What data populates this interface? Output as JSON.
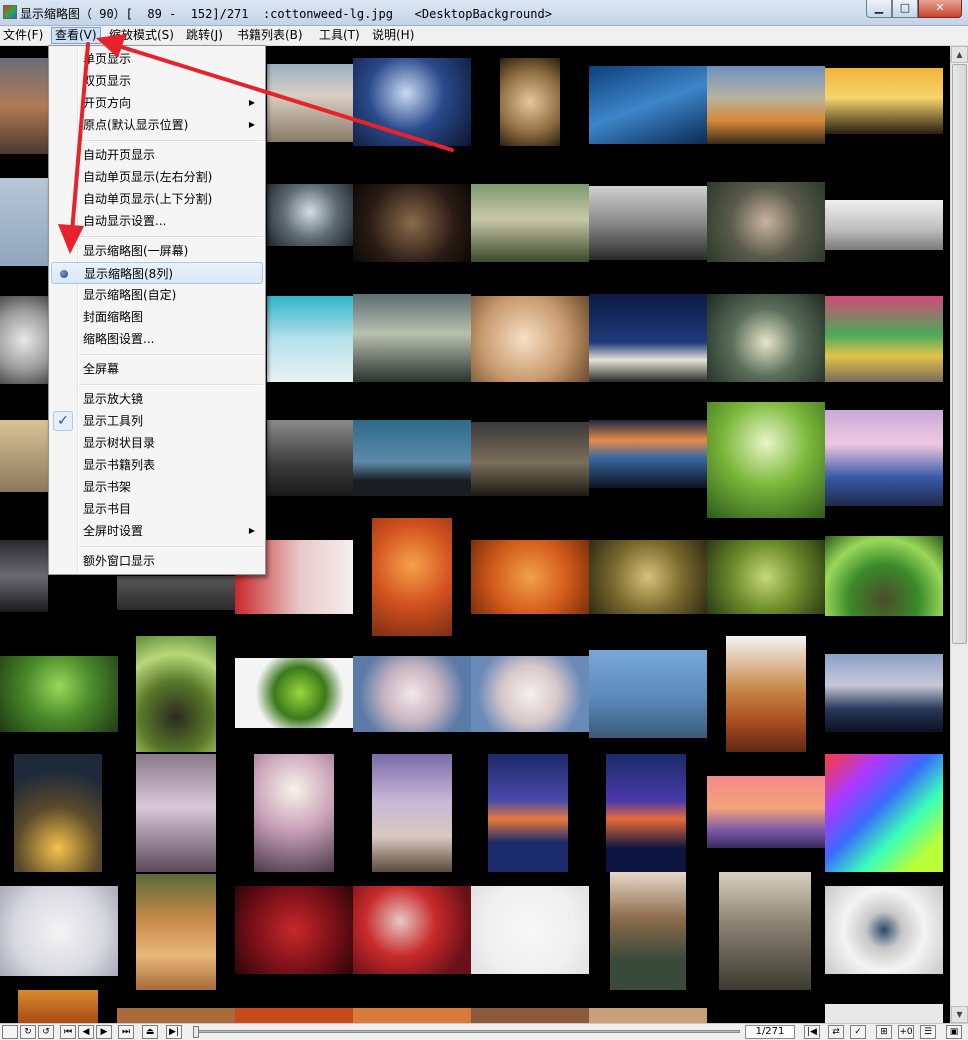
{
  "window": {
    "title": "显示缩略图（ 90）[  89 -  152]/271  :cottonweed-lg.jpg   <DesktopBackground>",
    "minimize_glyph": "▁",
    "maximize_glyph": "□",
    "close_glyph": "✕"
  },
  "menubar": {
    "file": "文件(F)",
    "view": "查看(V)",
    "zoom": "缩放模式(S)",
    "jump": "跳转(J)",
    "books": "书籍列表(B)",
    "tools": "工具(T)",
    "help": "说明(H)"
  },
  "view_menu": {
    "single_page": "单页显示",
    "double_page": "双页显示",
    "page_direction": "开页方向",
    "origin": "原点(默认显示位置)",
    "auto_open_page": "自动开页显示",
    "auto_single_lr": "自动单页显示(左右分割)",
    "auto_single_tb": "自动单页显示(上下分割)",
    "auto_display_settings": "自动显示设置...",
    "thumbs_one_screen": "显示缩略图(一屏幕)",
    "thumbs_8_cols": "显示缩略图(8列)",
    "thumbs_custom": "显示缩略图(自定)",
    "cover_thumbs": "封面缩略图",
    "thumb_settings": "缩略图设置...",
    "fullscreen": "全屏幕",
    "show_magnifier": "显示放大镜",
    "show_toolbar": "显示工具列",
    "show_tree": "显示树状目录",
    "show_book_list": "显示书籍列表",
    "show_bookshelf": "显示书架",
    "show_book_index": "显示书目",
    "fullscreen_settings": "全屏时设置",
    "extra_window": "额外窗口显示",
    "submenu_arrow": "▶",
    "check_glyph": "✓"
  },
  "toolbar": {
    "page_counter": "1/271",
    "buttons": [
      "↻",
      "↺",
      "⏮",
      "◀",
      "▶",
      "⏭",
      "⏏",
      "▶|"
    ],
    "right_buttons": [
      "|◀",
      "⇄",
      "✓",
      "⊞",
      "+0",
      "☰",
      "▣"
    ]
  },
  "scrollbar": {
    "up_arrow": "▲",
    "down_arrow": "▼"
  },
  "colors": {
    "accent": "#e8222a",
    "menu_highlight": "#cde0f7",
    "background": "#000000"
  }
}
